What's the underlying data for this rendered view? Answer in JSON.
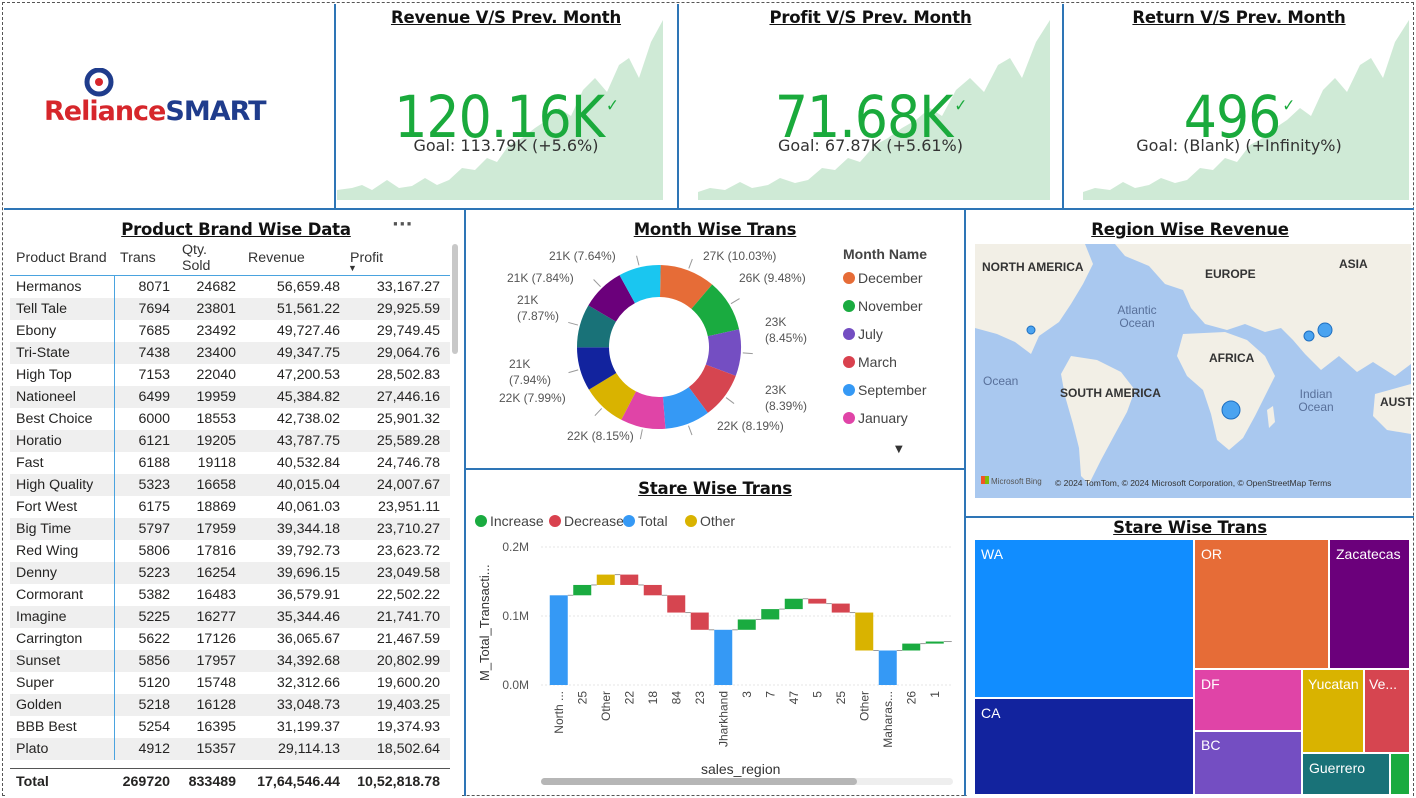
{
  "logo": {
    "brand": "Reliance",
    "sub": "SMART"
  },
  "kpis": [
    {
      "title": "Revenue V/S Prev. Month",
      "value": "120.16K",
      "goal": "Goal: 113.79K (+5.6%)"
    },
    {
      "title": "Profit V/S Prev. Month",
      "value": "71.68K",
      "goal": "Goal: 67.87K (+5.61%)"
    },
    {
      "title": "Return V/S Prev. Month",
      "value": "496",
      "goal": "Goal: (Blank) (+Infinity%)"
    }
  ],
  "table": {
    "title": "Product Brand Wise Data",
    "more": "···",
    "columns": [
      "Product Brand",
      "Trans",
      "Qty. Sold",
      "Revenue",
      "Profit"
    ],
    "rows": [
      [
        "Hermanos",
        "8071",
        "24682",
        "56,659.48",
        "33,167.27"
      ],
      [
        "Tell Tale",
        "7694",
        "23801",
        "51,561.22",
        "29,925.59"
      ],
      [
        "Ebony",
        "7685",
        "23492",
        "49,727.46",
        "29,749.45"
      ],
      [
        "Tri-State",
        "7438",
        "23400",
        "49,347.75",
        "29,064.76"
      ],
      [
        "High Top",
        "7153",
        "22040",
        "47,200.53",
        "28,502.83"
      ],
      [
        "Nationeel",
        "6499",
        "19959",
        "45,384.82",
        "27,446.16"
      ],
      [
        "Best Choice",
        "6000",
        "18553",
        "42,738.02",
        "25,901.32"
      ],
      [
        "Horatio",
        "6121",
        "19205",
        "43,787.75",
        "25,589.28"
      ],
      [
        "Fast",
        "6188",
        "19118",
        "40,532.84",
        "24,746.78"
      ],
      [
        "High Quality",
        "5323",
        "16658",
        "40,015.04",
        "24,007.67"
      ],
      [
        "Fort West",
        "6175",
        "18869",
        "40,061.03",
        "23,951.11"
      ],
      [
        "Big Time",
        "5797",
        "17959",
        "39,344.18",
        "23,710.27"
      ],
      [
        "Red Wing",
        "5806",
        "17816",
        "39,792.73",
        "23,623.72"
      ],
      [
        "Denny",
        "5223",
        "16254",
        "39,696.15",
        "23,049.58"
      ],
      [
        "Cormorant",
        "5382",
        "16483",
        "36,579.91",
        "22,502.22"
      ],
      [
        "Imagine",
        "5225",
        "16277",
        "35,344.46",
        "21,741.70"
      ],
      [
        "Carrington",
        "5622",
        "17126",
        "36,065.67",
        "21,467.59"
      ],
      [
        "Sunset",
        "5856",
        "17957",
        "34,392.68",
        "20,802.99"
      ],
      [
        "Super",
        "5120",
        "15748",
        "32,312.66",
        "19,600.20"
      ],
      [
        "Golden",
        "5218",
        "16128",
        "33,048.73",
        "19,403.25"
      ],
      [
        "BBB Best",
        "5254",
        "16395",
        "31,199.37",
        "19,374.93"
      ],
      [
        "Plato",
        "4912",
        "15357",
        "29,114.13",
        "18,502.64"
      ]
    ],
    "total": [
      "Total",
      "269720",
      "833489",
      "17,64,546.44",
      "10,52,818.78"
    ]
  },
  "donut": {
    "title": "Month Wise Trans",
    "legend_title": "Month Name",
    "legend": [
      {
        "name": "December",
        "color": "#e66c37"
      },
      {
        "name": "November",
        "color": "#1aab40"
      },
      {
        "name": "July",
        "color": "#744ec2"
      },
      {
        "name": "March",
        "color": "#d9414e"
      },
      {
        "name": "September",
        "color": "#3599f5"
      },
      {
        "name": "January",
        "color": "#e044a7"
      }
    ],
    "labels": [
      "27K (10.03%)",
      "26K (9.48%)",
      "23K (8.45%)",
      "23K (8.39%)",
      "22K (8.19%)",
      "22K (8.15%)",
      "22K (7.99%)",
      "21K (7.94%)",
      "21K (7.87%)",
      "21K (7.84%)",
      "21K (7.64%)"
    ]
  },
  "map": {
    "title": "Region Wise Revenue",
    "labels": [
      "NORTH AMERICA",
      "EUROPE",
      "ASIA",
      "Atlantic Ocean",
      "AFRICA",
      "Ocean",
      "SOUTH AMERICA",
      "Indian Ocean",
      "AUST"
    ],
    "attribution": "© 2024 TomTom, © 2024 Microsoft Corporation, © OpenStreetMap  Terms",
    "bing": "Microsoft Bing"
  },
  "waterfall": {
    "title": "Stare Wise Trans",
    "legend": [
      {
        "name": "Increase",
        "color": "#1aab40"
      },
      {
        "name": "Decrease",
        "color": "#d9414e"
      },
      {
        "name": "Total",
        "color": "#3599f5"
      },
      {
        "name": "Other",
        "color": "#d9b300"
      }
    ],
    "ylabel": "M_Total_Transacti...",
    "xlabel": "sales_region",
    "yticks": [
      "0.2M",
      "0.1M",
      "0.0M"
    ]
  },
  "treemap": {
    "title": "Stare Wise Trans",
    "items": [
      "WA",
      "OR",
      "Zacatecas",
      "CA",
      "DF",
      "Yucatan",
      "Ve...",
      "BC",
      "Guerrero"
    ]
  },
  "chart_data": [
    {
      "type": "pie",
      "title": "Month Wise Trans",
      "categories": [
        "December",
        "November",
        "July",
        "March",
        "September",
        "January",
        "",
        "",
        "",
        "",
        ""
      ],
      "values": [
        10.03,
        9.48,
        8.45,
        8.39,
        8.19,
        8.15,
        7.99,
        7.94,
        7.87,
        7.84,
        7.64
      ],
      "value_labels": [
        "27K",
        "26K",
        "23K",
        "23K",
        "22K",
        "22K",
        "22K",
        "21K",
        "21K",
        "21K",
        "21K"
      ]
    },
    {
      "type": "bar",
      "title": "Stare Wise Trans",
      "xlabel": "sales_region",
      "ylabel": "M_Total_Transacti...",
      "ylim": [
        0,
        0.2
      ],
      "categories": [
        "North ...",
        "25",
        "Other",
        "22",
        "18",
        "84",
        "23",
        "Jharkhand",
        "3",
        "7",
        "47",
        "5",
        "25",
        "Other",
        "Maharas...",
        "26",
        "1"
      ],
      "values": [
        0.13,
        0.145,
        0.16,
        0.145,
        0.13,
        0.105,
        0.08,
        0.08,
        0.095,
        0.11,
        0.125,
        0.118,
        0.105,
        0.05,
        0.05,
        0.06,
        0.063
      ]
    }
  ]
}
